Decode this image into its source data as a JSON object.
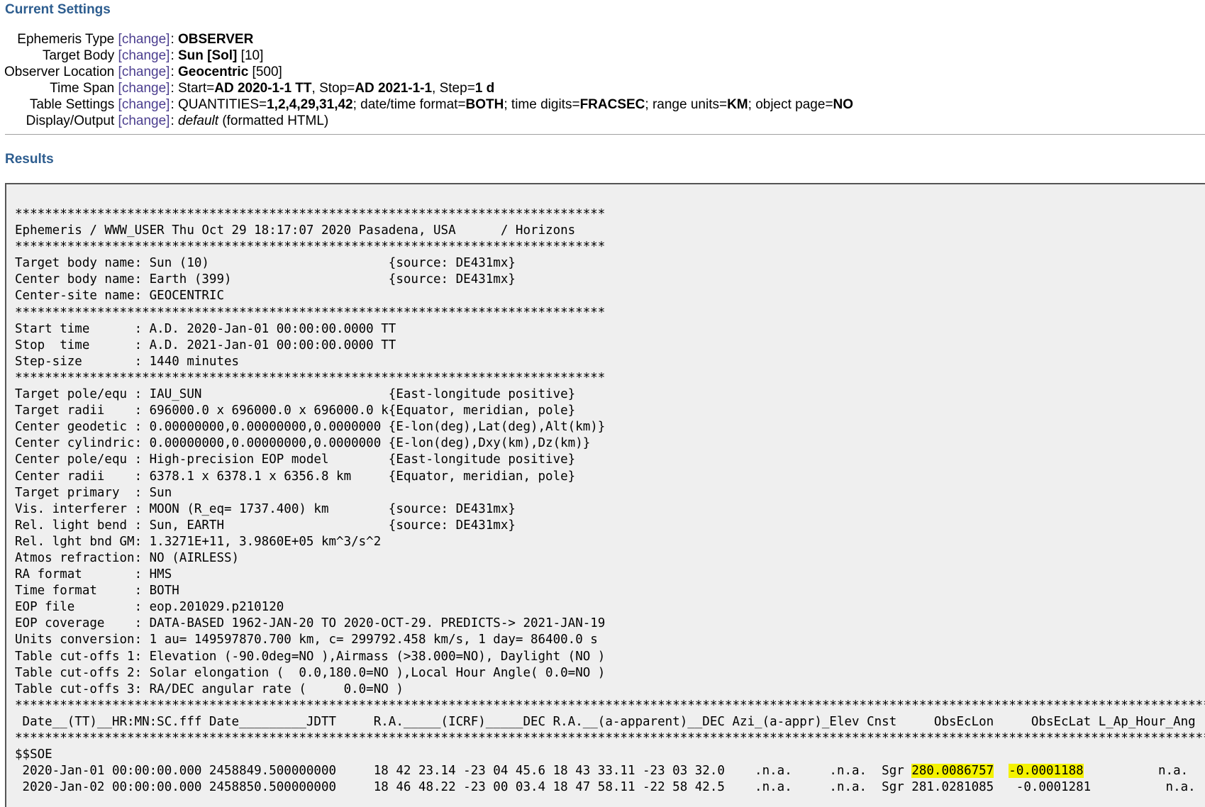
{
  "current_settings_title": "Current Settings",
  "results_title": "Results",
  "change_label": "change",
  "settings": {
    "ephemeris_type": {
      "label": "Ephemeris Type",
      "value": "OBSERVER"
    },
    "target_body": {
      "label": "Target Body",
      "value": "Sun [Sol]",
      "extra": "[10]"
    },
    "observer_location": {
      "label": "Observer Location",
      "value": "Geocentric",
      "extra": "[500]"
    },
    "time_span": {
      "label": "Time Span",
      "start_prefix": "Start=",
      "start": "AD 2020-1-1 TT",
      "stop_prefix": ", Stop=",
      "stop": "AD 2021-1-1",
      "step_prefix": ", Step=",
      "step": "1 d"
    },
    "table_settings": {
      "label": "Table Settings",
      "quantities_prefix": "QUANTITIES=",
      "quantities": "1,2,4,29,31,42",
      "datetime_prefix": "; date/time format=",
      "datetime": "BOTH",
      "digits_prefix": "; time digits=",
      "digits": "FRACSEC",
      "range_prefix": "; range units=",
      "range": "KM",
      "objpage_prefix": "; object page=",
      "objpage": "NO"
    },
    "display_output": {
      "label": "Display/Output",
      "value": "default",
      "extra": "(formatted HTML)"
    }
  },
  "output": {
    "pre_lines": [
      "*******************************************************************************",
      "Ephemeris / WWW_USER Thu Oct 29 18:17:07 2020 Pasadena, USA      / Horizons",
      "*******************************************************************************",
      "Target body name: Sun (10)                        {source: DE431mx}",
      "Center body name: Earth (399)                     {source: DE431mx}",
      "Center-site name: GEOCENTRIC",
      "*******************************************************************************",
      "Start time      : A.D. 2020-Jan-01 00:00:00.0000 TT",
      "Stop  time      : A.D. 2021-Jan-01 00:00:00.0000 TT",
      "Step-size       : 1440 minutes",
      "*******************************************************************************",
      "Target pole/equ : IAU_SUN                         {East-longitude positive}",
      "Target radii    : 696000.0 x 696000.0 x 696000.0 k{Equator, meridian, pole}",
      "Center geodetic : 0.00000000,0.00000000,0.0000000 {E-lon(deg),Lat(deg),Alt(km)}",
      "Center cylindric: 0.00000000,0.00000000,0.0000000 {E-lon(deg),Dxy(km),Dz(km)}",
      "Center pole/equ : High-precision EOP model        {East-longitude positive}",
      "Center radii    : 6378.1 x 6378.1 x 6356.8 km     {Equator, meridian, pole}",
      "Target primary  : Sun",
      "Vis. interferer : MOON (R_eq= 1737.400) km        {source: DE431mx}",
      "Rel. light bend : Sun, EARTH                      {source: DE431mx}",
      "Rel. lght bnd GM: 1.3271E+11, 3.9860E+05 km^3/s^2",
      "Atmos refraction: NO (AIRLESS)",
      "RA format       : HMS",
      "Time format     : BOTH",
      "EOP file        : eop.201029.p210120",
      "EOP coverage    : DATA-BASED 1962-JAN-20 TO 2020-OCT-29. PREDICTS-> 2021-JAN-19",
      "Units conversion: 1 au= 149597870.700 km, c= 299792.458 km/s, 1 day= 86400.0 s",
      "Table cut-offs 1: Elevation (-90.0deg=NO ),Airmass (>38.000=NO), Daylight (NO )",
      "Table cut-offs 2: Solar elongation (  0.0,180.0=NO ),Local Hour Angle( 0.0=NO )",
      "Table cut-offs 3: RA/DEC angular rate (     0.0=NO )",
      "*****************************************************************************************************************************************************************",
      " Date__(TT)__HR:MN:SC.fff Date_________JDTT     R.A._____(ICRF)_____DEC R.A.__(a-apparent)__DEC Azi_(a-appr)_Elev Cnst     ObsEcLon     ObsEcLat L_Ap_Hour_Ang",
      "*****************************************************************************************************************************************************************",
      "$$SOE"
    ],
    "row1": {
      "prefix": " 2020-Jan-01 00:00:00.000 2458849.500000000     18 42 23.14 -23 04 45.6 18 43 33.11 -23 03 32.0    .n.a.     .n.a.  Sgr ",
      "obs_ec_lon": "280.0086757",
      "gap": "  ",
      "obs_ec_lat": "-0.0001188",
      "suffix": "          n.a."
    },
    "row2": " 2020-Jan-02 00:00:00.000 2458850.500000000     18 46 48.22 -23 00 03.4 18 47 58.11 -22 58 42.5    .n.a.     .n.a.  Sgr 281.0281085   -0.0001281          n.a."
  }
}
